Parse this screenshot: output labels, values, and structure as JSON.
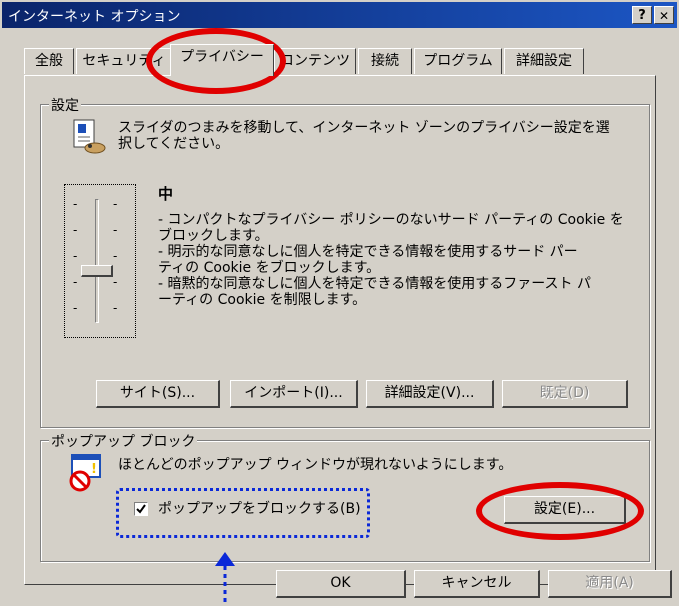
{
  "window": {
    "title": "インターネット オプション",
    "help_label": "?",
    "close_label": "✕"
  },
  "tabs": [
    {
      "label": "全般"
    },
    {
      "label": "セキュリティ"
    },
    {
      "label": "プライバシー"
    },
    {
      "label": "コンテンツ"
    },
    {
      "label": "接続"
    },
    {
      "label": "プログラム"
    },
    {
      "label": "詳細設定"
    }
  ],
  "settings": {
    "group_label": "設定",
    "instruction_line1": "スライダのつまみを移動して、インターネット ゾーンのプライバシー設定を選",
    "instruction_line2": "択してください。",
    "level": "中",
    "description": [
      "- コンパクトなプライバシー ポリシーのないサード パーティの Cookie を",
      "ブロックします。",
      "- 明示的な同意なしに個人を特定できる情報を使用するサード パー",
      "ティの Cookie をブロックします。",
      "- 暗黙的な同意なしに個人を特定できる情報を使用するファースト パ",
      "ーティの Cookie を制限します。"
    ],
    "slider_ticks": [
      "-",
      "-",
      "-",
      "-",
      "-",
      "-",
      "-",
      "-",
      "-",
      "-"
    ],
    "buttons": {
      "sites": "サイト(S)...",
      "import": "インポート(I)...",
      "advanced": "詳細設定(V)...",
      "default": "既定(D)"
    }
  },
  "popup": {
    "group_label": "ポップアップ ブロック",
    "description": "ほとんどのポップアップ ウィンドウが現れないようにします。",
    "checkbox_label": "ポップアップをブロックする(B)",
    "checkbox_checked": true,
    "settings_button": "設定(E)..."
  },
  "footer": {
    "ok": "OK",
    "cancel": "キャンセル",
    "apply": "適用(A)"
  },
  "colors": {
    "titlebar": "#0a246a",
    "annotation_red": "#e00000",
    "annotation_blue": "#0a28d8",
    "dialog_face": "#d4d0c8"
  }
}
